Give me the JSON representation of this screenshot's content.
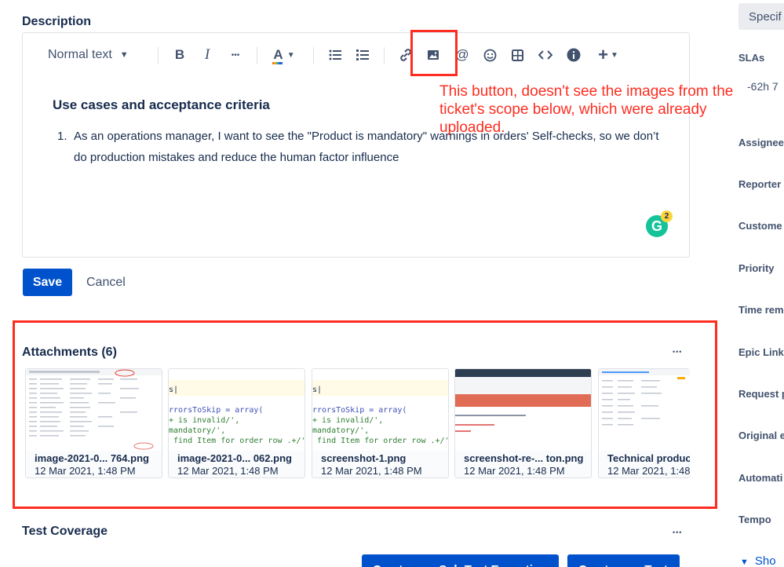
{
  "description": {
    "title": "Description"
  },
  "toolbar": {
    "text_style": "Normal text",
    "bold": "B",
    "italic": "I",
    "more_formatting": "•••",
    "text_color": "A",
    "icons": [
      "bullet-list-icon",
      "numbered-list-icon",
      "link-icon",
      "image-icon",
      "mention-icon",
      "emoji-icon",
      "table-icon",
      "code-icon",
      "info-icon",
      "plus-icon"
    ]
  },
  "document": {
    "heading": "Use cases and  acceptance criteria",
    "list_number": "1.",
    "list_item": "As an operations manager, I want to see the \"Product is mandatory\" warnings in orders' Self-checks, so we don’t do production mistakes and reduce the human factor influence"
  },
  "grammarly": {
    "letter": "G",
    "count": "2"
  },
  "annotation": {
    "text": "This button, doesn't see the images from the ticket's scope below, which were already uploaded."
  },
  "actions": {
    "save": "Save",
    "cancel": "Cancel"
  },
  "attachments": {
    "title": "Attachments (6)",
    "more": "•••",
    "items": [
      {
        "name": "image-2021-0... 764.png",
        "date": "12 Mar 2021, 1:48 PM"
      },
      {
        "name": "image-2021-0... 062.png",
        "date": "12 Mar 2021, 1:48 PM"
      },
      {
        "name": "screenshot-1.png",
        "date": "12 Mar 2021, 1:48 PM"
      },
      {
        "name": "screenshot-re-... ton.png",
        "date": "12 Mar 2021, 1:48 PM"
      },
      {
        "name": "Technical product",
        "date": "12 Mar 2021, 1:48"
      }
    ],
    "code_snippet": {
      "line1": "s|",
      "line2": "rrorsToSkip = array(",
      "line3": "+ is invalid/',",
      "line4": "mandatory/',",
      "line5": " find Item for order row .+/',"
    }
  },
  "test_coverage": {
    "title": "Test Coverage",
    "more": "•••"
  },
  "bottom_buttons": {
    "create_sub_test_execution": "Create new Sub Test Execution",
    "create_test": "Create new Test"
  },
  "sidebar": {
    "tab": "Specif",
    "slas_label": "SLAs",
    "sla_value": "-62h 7",
    "fields": [
      "Assignee",
      "Reporter",
      "Custome",
      "Priority",
      "Time rem",
      "Epic Link",
      "Request p",
      "Original e",
      "Automati",
      "Tempo"
    ],
    "show_more": "Sho"
  }
}
